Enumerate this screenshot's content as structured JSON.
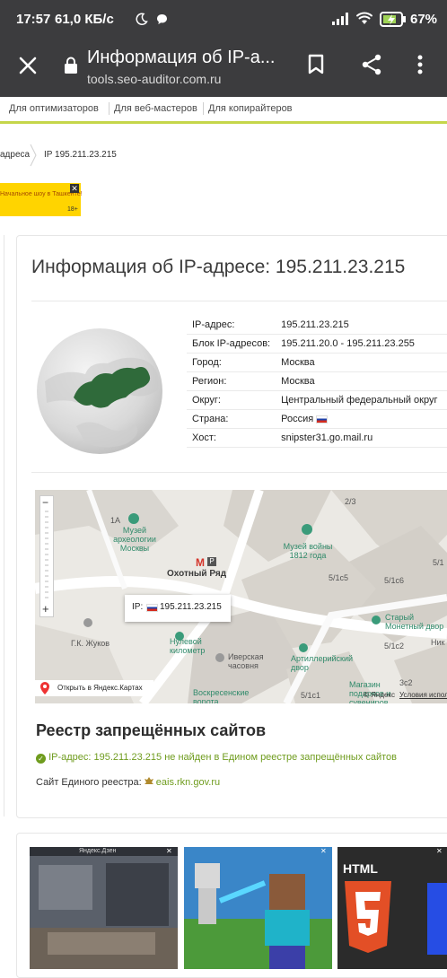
{
  "statusbar": {
    "time": "17:57",
    "speed": "61,0 КБ/с",
    "battery": "67%",
    "colors": {
      "bg": "#3c3c3e",
      "text": "#ffffff"
    }
  },
  "toolbar": {
    "title": "Информация об IP-а...",
    "url": "tools.seo-auditor.com.ru"
  },
  "site_nav": {
    "items": [
      "Для оптимизаторов",
      "Для веб-мастеров",
      "Для копирайтеров"
    ]
  },
  "breadcrumb": {
    "items": [
      "адреса",
      "IP 195.211.23.215"
    ]
  },
  "ad": {
    "text": "Начальное шоу в Ташкенте!",
    "age": "18+"
  },
  "page": {
    "title": "Информация об IP-адресе: 195.211.23.215"
  },
  "info_table": {
    "rows": [
      {
        "label": "IP-адрес:",
        "value": "195.211.23.215"
      },
      {
        "label": "Блок IP-адресов:",
        "value": "195.211.20.0 - 195.211.23.255"
      },
      {
        "label": "Город:",
        "value": "Москва"
      },
      {
        "label": "Регион:",
        "value": "Москва"
      },
      {
        "label": "Округ:",
        "value": "Центральный федеральный округ"
      },
      {
        "label": "Страна:",
        "value": "Россия"
      },
      {
        "label": "Хост:",
        "value": "snipster31.go.mail.ru"
      }
    ]
  },
  "map": {
    "popup_prefix": "IP:",
    "popup_ip": "195.211.23.215",
    "open_in_maps": "Открыть в Яндекс.Картах",
    "copyright": "© Яндекс",
    "terms": "Условия испол",
    "labels": {
      "museum_arch": "Музей археологии Москвы",
      "museum_war": "Музей войны 1812 года",
      "metro": "Охотный Ряд",
      "zero_km": "Нулевой километр",
      "iver": "Иверская часовня",
      "voskr": "Воскресенские ворота",
      "artil": "Артиллерийский двор",
      "stary": "Старый Монетный двор",
      "zhukov": "Г.К. Жуков",
      "magazin": "Магазин подарков и сувениров",
      "n1a": "1А",
      "n23": "2/3",
      "n51c5": "5/1с5",
      "n51c6": "5/1с6",
      "n51c2": "5/1с2",
      "n51c1": "5/1с1",
      "n3c2": "3с2",
      "n51": "5/1",
      "nik": "Ник"
    }
  },
  "registry": {
    "title": "Реестр запрещённых сайтов",
    "status": "IP-адрес: 195.211.23.215 не найден в Едином реестре запрещённых сайтов",
    "site_label": "Сайт Единого реестра:",
    "site_link": "eais.rkn.gov.ru"
  },
  "promo": {
    "thumb1_caption": "Яндекс.Дзен",
    "thumb3_caption": "HTML"
  },
  "colors": {
    "accent_green": "#6f9c1e",
    "nav_green": "#c5d64a",
    "ad_yellow": "#ffd400",
    "map_building": "#d7d3cc"
  }
}
